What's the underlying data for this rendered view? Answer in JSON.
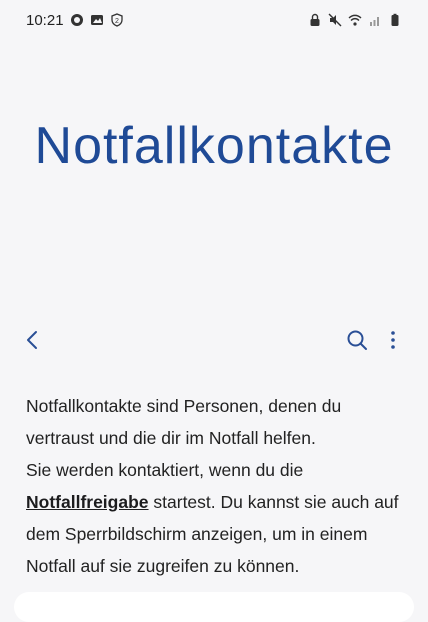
{
  "status_bar": {
    "time": "10:21",
    "left_icons": [
      "whatsapp-icon",
      "gallery-icon",
      "shield-2-icon"
    ],
    "right_icons": [
      "lock-icon",
      "mute-icon",
      "wifi-icon",
      "signal-icon",
      "battery-icon"
    ]
  },
  "page": {
    "title": "Notfallkontakte"
  },
  "toolbar": {
    "back_icon": "chevron-left-icon",
    "search_icon": "search-icon",
    "more_icon": "more-vertical-icon"
  },
  "description": {
    "line1": "Notfallkontakte sind Personen, denen du vertraust und die dir im Notfall helfen.",
    "line2_before": "Sie werden kontaktiert, wenn du die ",
    "link": "Notfallfreigabe",
    "line2_after": " startest. Du kannst sie auch auf dem Sperrbildschirm anzeigen, um in einem Notfall auf sie zugreifen zu können."
  },
  "colors": {
    "accent": "#1f4a96",
    "background": "#f6f6f8"
  }
}
